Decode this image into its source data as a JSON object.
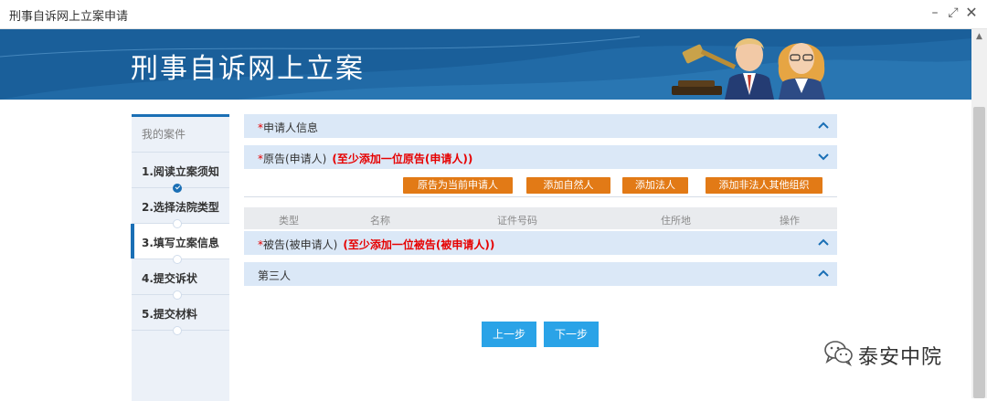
{
  "window": {
    "title": "刑事自诉网上立案申请",
    "minimize": "–",
    "maximize": "⤢",
    "close": "✕"
  },
  "banner": {
    "title": "刑事自诉网上立案"
  },
  "steps": {
    "header": "我的案件",
    "items": [
      {
        "label": "1.阅读立案须知",
        "done": true
      },
      {
        "label": "2.选择法院类型"
      },
      {
        "label": "3.填写立案信息",
        "active": true
      },
      {
        "label": "4.提交诉状"
      },
      {
        "label": "5.提交材料"
      }
    ]
  },
  "sections": {
    "applicant": {
      "required": "*",
      "title": "申请人信息"
    },
    "plaintiff": {
      "required": "*",
      "title": "原告(申请人)",
      "hint": "(至少添加一位原告(申请人))"
    },
    "defendant": {
      "required": "*",
      "title": "被告(被申请人)",
      "hint": "(至少添加一位被告(被申请人))"
    },
    "third_party": {
      "title": "第三人"
    }
  },
  "plaintiff_buttons": {
    "as_current": "原告为当前申请人",
    "add_natural": "添加自然人",
    "add_legal": "添加法人",
    "add_other": "添加非法人其他组织"
  },
  "table": {
    "columns": [
      "类型",
      "名称",
      "证件号码",
      "住所地",
      "操作"
    ]
  },
  "nav": {
    "prev": "上一步",
    "next": "下一步"
  },
  "watermark": {
    "text": "泰安中院"
  },
  "colors": {
    "banner": "#1a5f9a",
    "accent": "#1a6fb5",
    "orange_button": "#e27a16",
    "nav_button": "#2aa3e7",
    "required": "#e60000"
  }
}
